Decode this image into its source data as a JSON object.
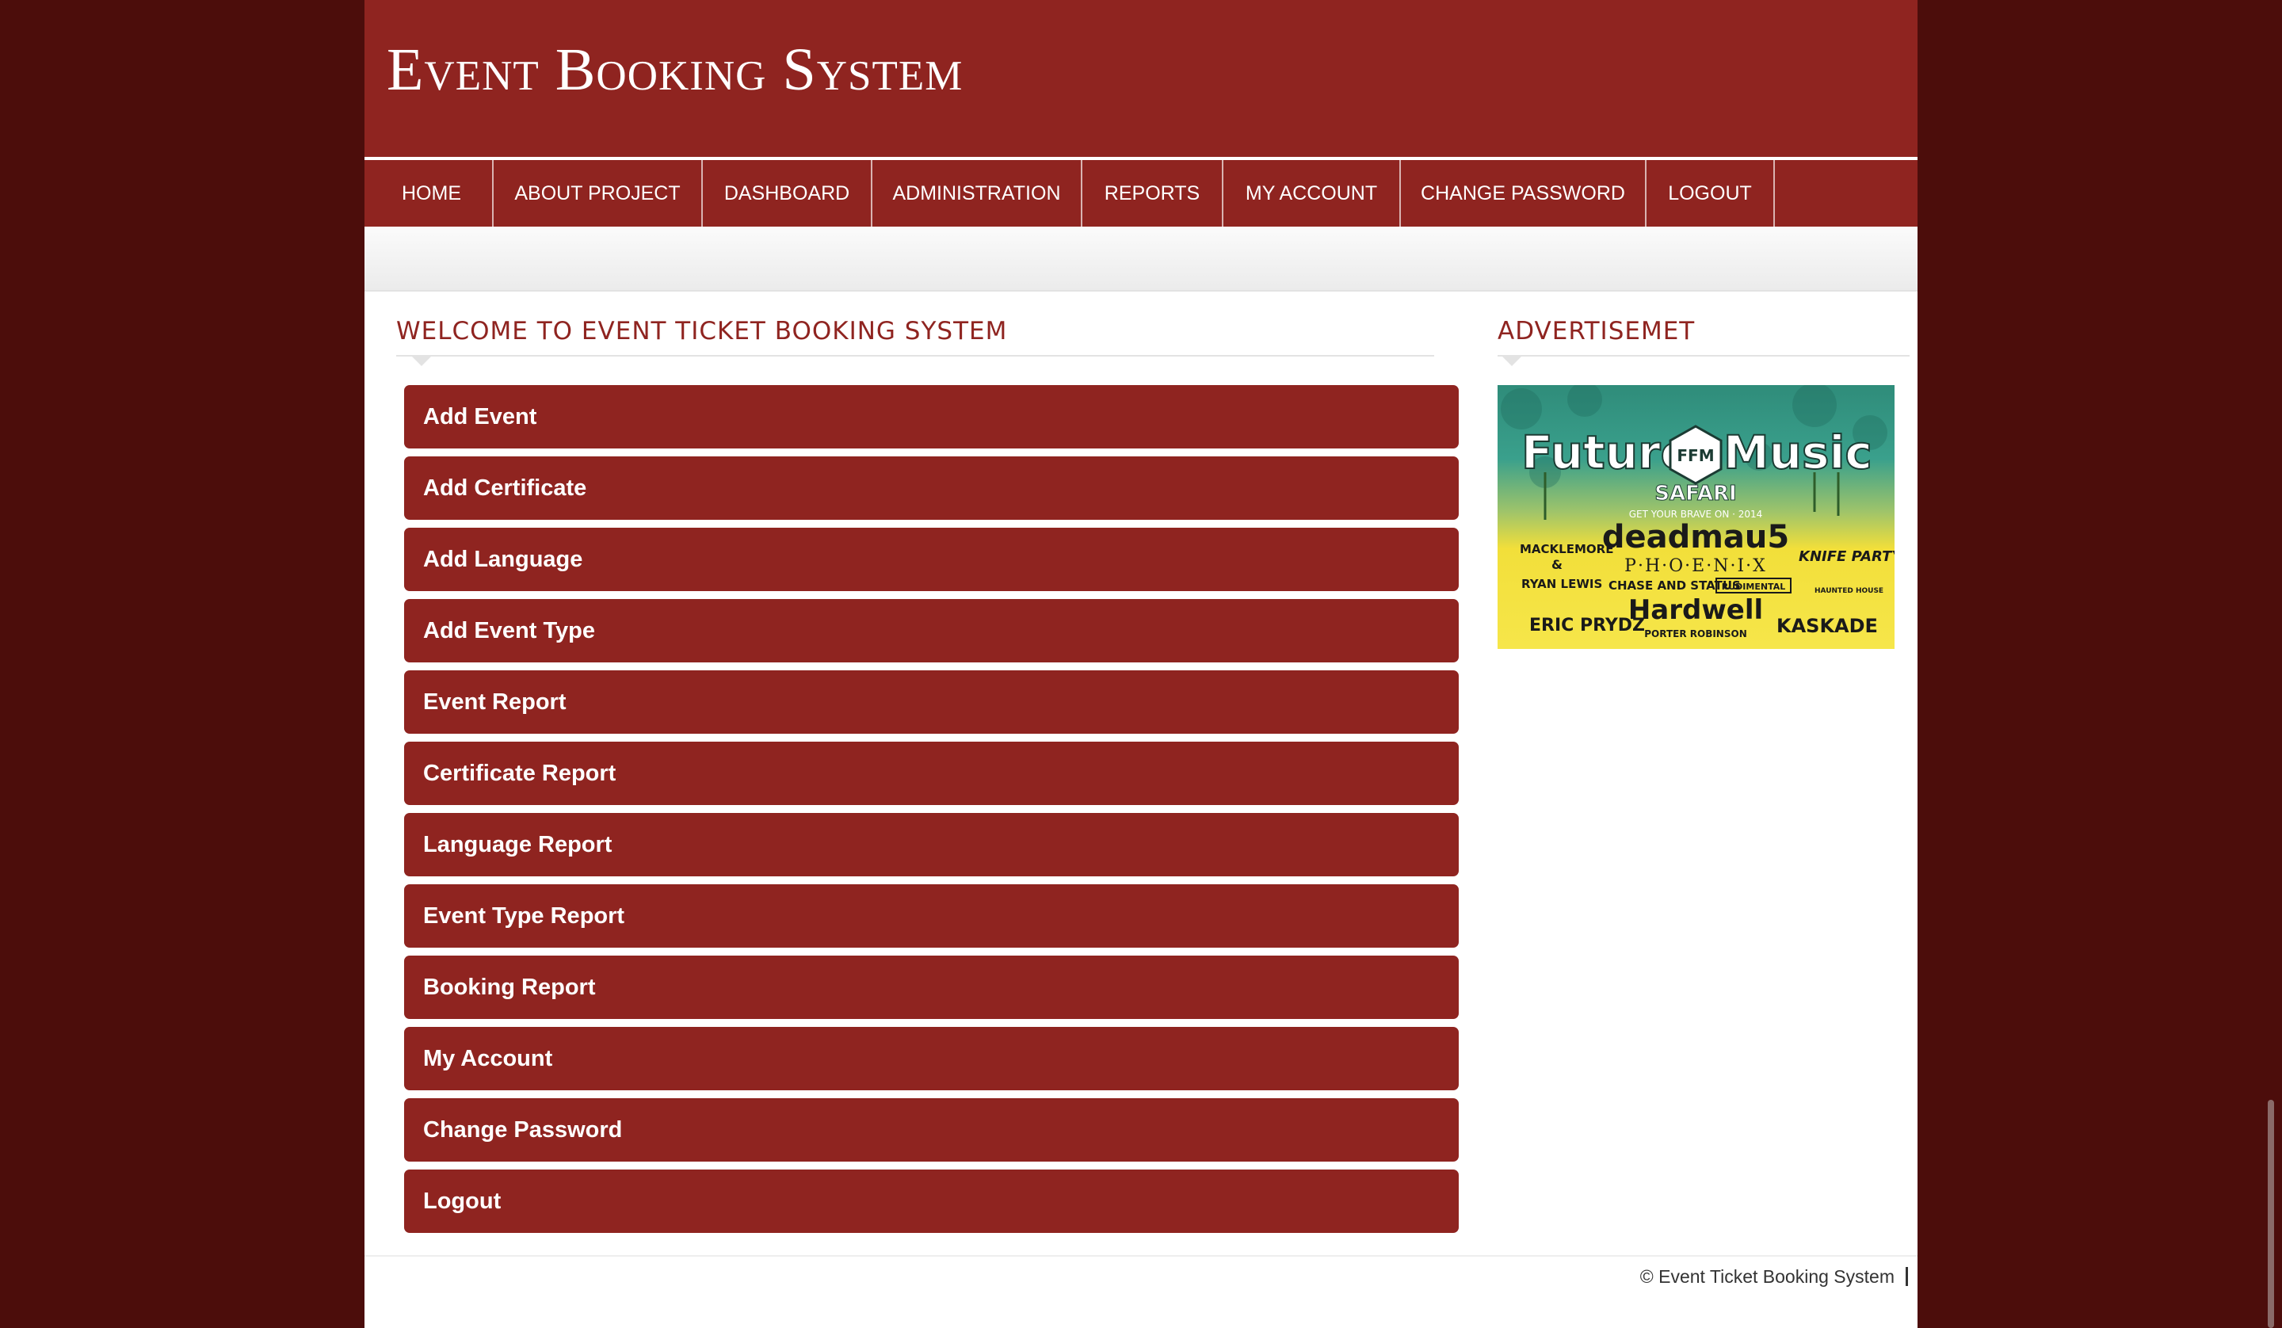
{
  "site": {
    "title": "Event Booking System"
  },
  "nav": {
    "items": [
      {
        "label": "HOME"
      },
      {
        "label": "ABOUT PROJECT"
      },
      {
        "label": "DASHBOARD"
      },
      {
        "label": "ADMINISTRATION"
      },
      {
        "label": "REPORTS"
      },
      {
        "label": "MY ACCOUNT"
      },
      {
        "label": "CHANGE PASSWORD"
      },
      {
        "label": "LOGOUT"
      }
    ]
  },
  "main": {
    "heading": "WELCOME TO EVENT TICKET BOOKING SYSTEM",
    "menu": [
      {
        "label": "Add Event"
      },
      {
        "label": "Add Certificate"
      },
      {
        "label": "Add Language"
      },
      {
        "label": "Add Event Type"
      },
      {
        "label": "Event Report"
      },
      {
        "label": "Certificate Report"
      },
      {
        "label": "Language Report"
      },
      {
        "label": "Event Type Report"
      },
      {
        "label": "Booking Report"
      },
      {
        "label": "My Account"
      },
      {
        "label": "Change Password"
      },
      {
        "label": "Logout"
      }
    ]
  },
  "sidebar": {
    "heading": "ADVERTISEMET",
    "ad": {
      "title_left": "Future",
      "title_right": "Music",
      "badge": "FFM",
      "subtitle": "SAFARI",
      "tagline": "GET YOUR BRAVE ON · 2014",
      "acts": {
        "headliner": "deadmau5",
        "left_top": "MACKLEMORE",
        "left_amp": "&",
        "left_bottom": "RYAN LEWIS",
        "center": "P·H·O·E·N·I·X",
        "right_top": "KNIFE PARTY",
        "right_bottom": "HAUNTED HOUSE",
        "row2_a": "CHASE AND STATUS",
        "row2_b": "RUDIMENTAL",
        "bottom_left": "ERIC PRYDZ",
        "bottom_center": "Hardwell",
        "bottom_center_sub": "PORTER ROBINSON",
        "bottom_right": "KASKADE"
      }
    }
  },
  "footer": {
    "copyright": "© Event Ticket Booking System"
  },
  "colors": {
    "brand": "#8f2420",
    "background": "#4c0d0b"
  }
}
